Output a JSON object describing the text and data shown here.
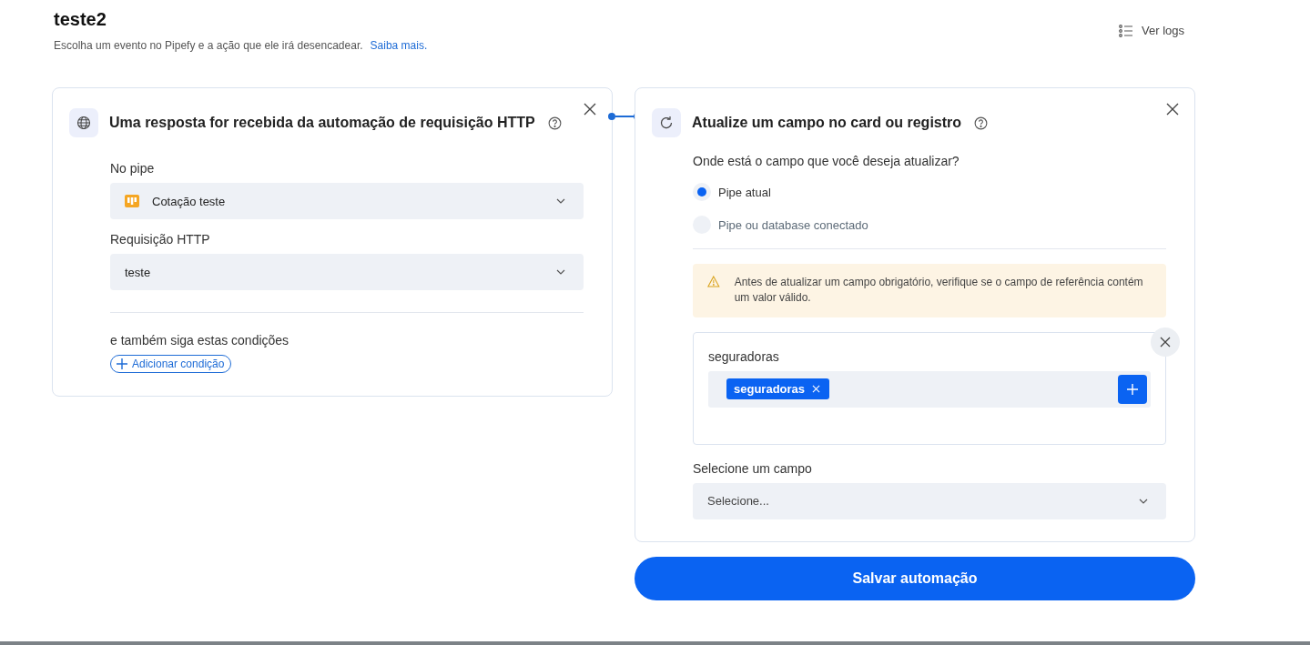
{
  "page": {
    "title": "teste2",
    "subtitle": "Escolha um evento no Pipefy e a ação que ele irá desencadear.",
    "link": "Saiba mais.",
    "logs_button": "Ver logs"
  },
  "trigger": {
    "title": "Uma resposta for recebida da automação de requisição HTTP",
    "fields": [
      {
        "label": "No pipe",
        "value": "Cotação teste",
        "kind": "pipe"
      },
      {
        "label": "Requisição HTTP",
        "value": "teste",
        "kind": "plain"
      }
    ],
    "conditions_label": "e também siga estas condições",
    "add_condition": "Adicionar condição"
  },
  "action": {
    "title": "Atualize um campo no card ou registro",
    "question": "Onde está o campo que você deseja atualizar?",
    "options": [
      {
        "label": "Pipe atual",
        "selected": true
      },
      {
        "label": "Pipe ou database conectado",
        "selected": false
      }
    ],
    "warning": "Antes de atualizar um campo obrigatório, verifique se o campo de referência contém um valor válido.",
    "field_card": {
      "title": "seguradoras",
      "tags": [
        "seguradoras"
      ]
    },
    "select_label": "Selecione um campo",
    "select": {
      "placeholder": "Selecione..."
    }
  },
  "save_button": "Salvar automação"
}
